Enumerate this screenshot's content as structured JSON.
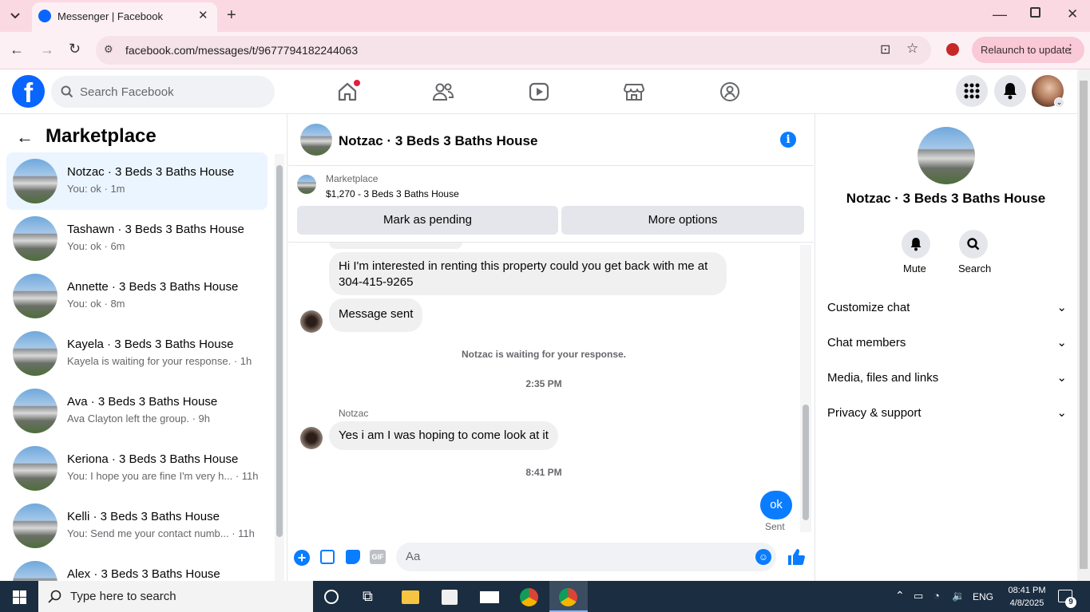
{
  "browser": {
    "tab_title": "Messenger | Facebook",
    "url": "facebook.com/messages/t/9677794182244063",
    "relaunch_label": "Relaunch to update"
  },
  "facebook": {
    "search_placeholder": "Search Facebook"
  },
  "left": {
    "title": "Marketplace",
    "conversations": [
      {
        "name": "Notzac · 3 Beds 3 Baths House",
        "snippet": "You: ok · 1m"
      },
      {
        "name": "Tashawn · 3 Beds 3 Baths House",
        "snippet": "You: ok · 6m"
      },
      {
        "name": "Annette · 3 Beds 3 Baths House",
        "snippet": "You: ok · 8m"
      },
      {
        "name": "Kayela · 3 Beds 3 Baths House",
        "snippet": "Kayela is waiting for your response. · 1h"
      },
      {
        "name": "Ava · 3 Beds 3 Baths House",
        "snippet": "Ava Clayton left the group. · 9h"
      },
      {
        "name": "Keriona · 3 Beds 3 Baths House",
        "snippet": "You: I hope you are fine I'm very h... · 11h"
      },
      {
        "name": "Kelli · 3 Beds 3 Baths House",
        "snippet": "You: Send me your contact numb... · 11h"
      },
      {
        "name": "Alex · 3 Beds 3 Baths House",
        "snippet": ""
      }
    ]
  },
  "chat": {
    "title": "Notzac · 3 Beds 3 Baths House",
    "listing_source": "Marketplace",
    "listing_text": "$1,270 - 3 Beds 3 Baths House",
    "mark_pending": "Mark as pending",
    "more_options": "More options",
    "msg1_line1": "Hi I'm interested in renting this property could you get back with me at",
    "msg1_line2": "304-415-9265",
    "msg2": "Message sent",
    "waiting": "Notzac is waiting for your response.",
    "time1": "2:35 PM",
    "sender": "Notzac",
    "msg3": "Yes i am I was hoping to come look at it",
    "time2": "8:41 PM",
    "my_msg": "ok",
    "status": "Sent",
    "input_placeholder": "Aa",
    "gif_label": "GIF"
  },
  "right": {
    "name": "Notzac · 3 Beds 3 Baths House",
    "mute": "Mute",
    "search": "Search",
    "sections": [
      "Customize chat",
      "Chat members",
      "Media, files and links",
      "Privacy & support"
    ]
  },
  "taskbar": {
    "search_placeholder": "Type here to search",
    "lang": "ENG",
    "time": "08:41 PM",
    "date": "4/8/2025",
    "notif_count": "9"
  },
  "colors": {
    "fb_blue": "#0866ff",
    "accent_blue": "#0a7cff"
  }
}
